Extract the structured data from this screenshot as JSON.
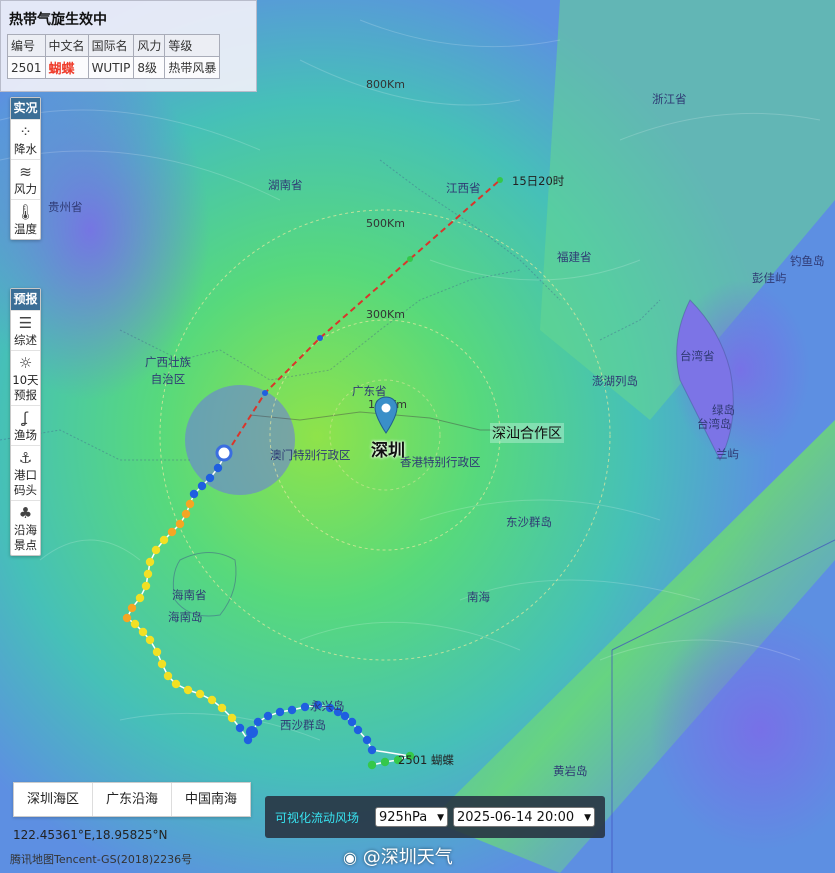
{
  "typhoon_panel": {
    "title": "热带气旋生效中",
    "headers": [
      "编号",
      "中文名",
      "国际名",
      "风力",
      "等级"
    ],
    "row": [
      "2501",
      "蝴蝶",
      "WUTIP",
      "8级",
      "热带风暴"
    ]
  },
  "toolbar_live": {
    "title": "实况",
    "items": [
      {
        "label": "降水",
        "icon": "rain-icon"
      },
      {
        "label": "风力",
        "icon": "wind-icon"
      },
      {
        "label": "温度",
        "icon": "thermometer-icon"
      }
    ]
  },
  "toolbar_forecast": {
    "title": "预报",
    "items": [
      {
        "label": "综述",
        "icon": "summary-icon"
      },
      {
        "label": "10天预报",
        "line1": "10天",
        "line2": "预报",
        "icon": "sun-cloud-icon"
      },
      {
        "label": "渔场",
        "icon": "fishing-icon"
      },
      {
        "label": "港口码头",
        "line1": "港口",
        "line2": "码头",
        "icon": "anchor-icon"
      },
      {
        "label": "沿海景点",
        "line1": "沿海",
        "line2": "景点",
        "icon": "palm-icon"
      }
    ]
  },
  "region_buttons": [
    "深圳海区",
    "广东沿海",
    "中国南海"
  ],
  "coordinates": "122.45361°E,18.95825°N",
  "copyright": "腾讯地图Tencent-GS(2018)2236号",
  "wind_control": {
    "label": "可视化流动风场",
    "level": "925hPa",
    "datetime": "2025-06-14 20:00"
  },
  "watermark": "@深圳天气",
  "map": {
    "city": "深圳",
    "zone": "深汕合作区",
    "distance_rings": [
      "800Km",
      "500Km",
      "300Km",
      "100Km"
    ],
    "track_end_time": "15日20时",
    "typhoon_tag": "2501 蝴蝶",
    "labels": [
      "浙江省",
      "湖南省",
      "江西省",
      "贵州省",
      "福建省",
      "广西壮族自治区",
      "广东省",
      "澳门特别行政区",
      "香港特别行政区",
      "海南省",
      "海南岛",
      "东沙群岛",
      "南海",
      "台湾省",
      "台湾岛",
      "澎湖列岛",
      "彭佳屿",
      "绿岛",
      "兰屿",
      "永兴岛",
      "西沙群岛",
      "黄岩岛",
      "钓鱼岛"
    ]
  },
  "colors": {
    "panel_header": "#3b6e96",
    "typhoon_name": "#ef3b2a",
    "wind_label": "#38e3f0",
    "track_forecast": "#d9352b"
  }
}
